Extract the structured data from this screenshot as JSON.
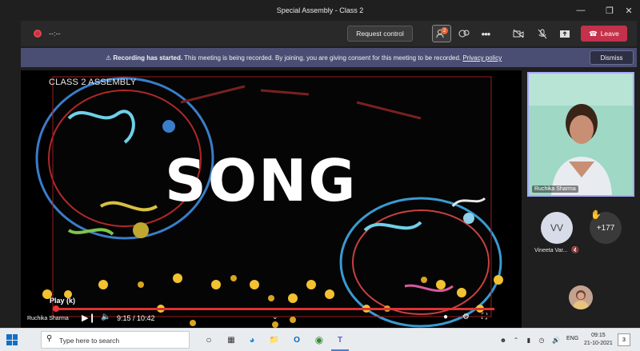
{
  "window": {
    "title": "Special Assembly - Class 2",
    "controls": [
      "minimize-icon",
      "restore-icon",
      "close-icon"
    ]
  },
  "toolbar": {
    "timer": "--:--",
    "request_control_label": "Request control",
    "people_badge": "2",
    "leave_label": "Leave",
    "icons": [
      "people-icon",
      "reactions-icon",
      "more-options-icon",
      "camera-off-icon",
      "mic-off-icon",
      "share-icon"
    ]
  },
  "notice": {
    "title": "Recording has started.",
    "message": "This meeting is being recorded. By joining, you are giving consent for this meeting to be recorded.",
    "link": "Privacy policy",
    "dismiss_label": "Dismiss"
  },
  "stage": {
    "slide_title": "CLASS 2 ASSEMBLY",
    "big_title": "SONG",
    "play_tooltip": "Play (k)",
    "time": "9:15 / 10:42",
    "progress": 0.0,
    "presenter": "Ruchika Sharma"
  },
  "participants": {
    "main_tile_name": "Ruchika Sharma",
    "vv_initials": "VV",
    "vv_name": "Vineeta Var...",
    "more_count": "+177"
  },
  "taskbar": {
    "search_placeholder": "Type here to search",
    "lang": "ENG",
    "time": "09:15",
    "date": "21-10-2021",
    "notif_count": "3"
  },
  "colors": {
    "leave": "#c4314b",
    "notice_bg": "#4a4e73",
    "accent": "#a9a8ff"
  }
}
